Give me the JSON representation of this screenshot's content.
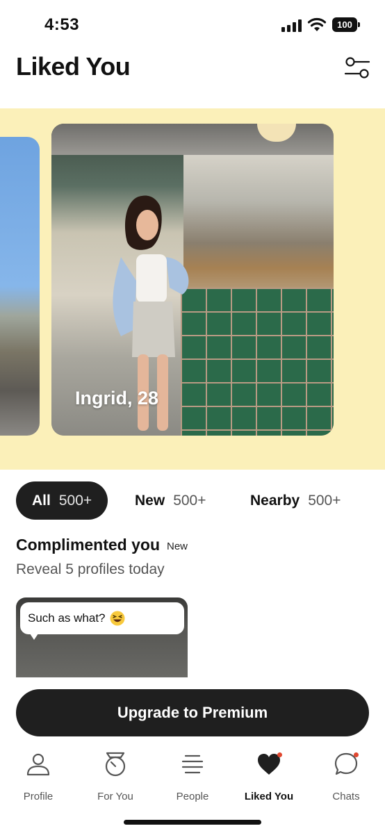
{
  "status_bar": {
    "time": "4:53",
    "battery": "100",
    "icons": [
      "signal-icon",
      "wifi-icon",
      "battery-icon"
    ]
  },
  "header": {
    "title": "Liked You",
    "filter_icon": "sliders-icon"
  },
  "carousel": {
    "background": "#fbf0b9",
    "cards": [
      {
        "name": ""
      },
      {
        "name": "Ingrid, 28"
      }
    ],
    "active_index": 1
  },
  "tabs": [
    {
      "label": "All",
      "count": "500+",
      "selected": true
    },
    {
      "label": "New",
      "count": "500+",
      "selected": false
    },
    {
      "label": "Nearby",
      "count": "500+",
      "selected": false
    }
  ],
  "complimented": {
    "title": "Complimented you",
    "badge": "New",
    "subtitle": "Reveal 5 profiles today",
    "card": {
      "message": "Such as what?",
      "emoji": "grinning-squinting-face"
    }
  },
  "upgrade": {
    "label": "Upgrade to Premium"
  },
  "bottom_nav": {
    "items": [
      {
        "label": "Profile",
        "icon": "person-icon",
        "active": false,
        "badge": false
      },
      {
        "label": "For You",
        "icon": "compass-icon",
        "active": false,
        "badge": false
      },
      {
        "label": "People",
        "icon": "people-stack-icon",
        "active": false,
        "badge": false
      },
      {
        "label": "Liked You",
        "icon": "heart-icon",
        "active": true,
        "badge": true
      },
      {
        "label": "Chats",
        "icon": "chat-bubble-icon",
        "active": false,
        "badge": true
      }
    ]
  },
  "colors": {
    "accent_dark": "#1f1f1f",
    "notification_dot": "#e0472f",
    "banner": "#fbf0b9"
  }
}
